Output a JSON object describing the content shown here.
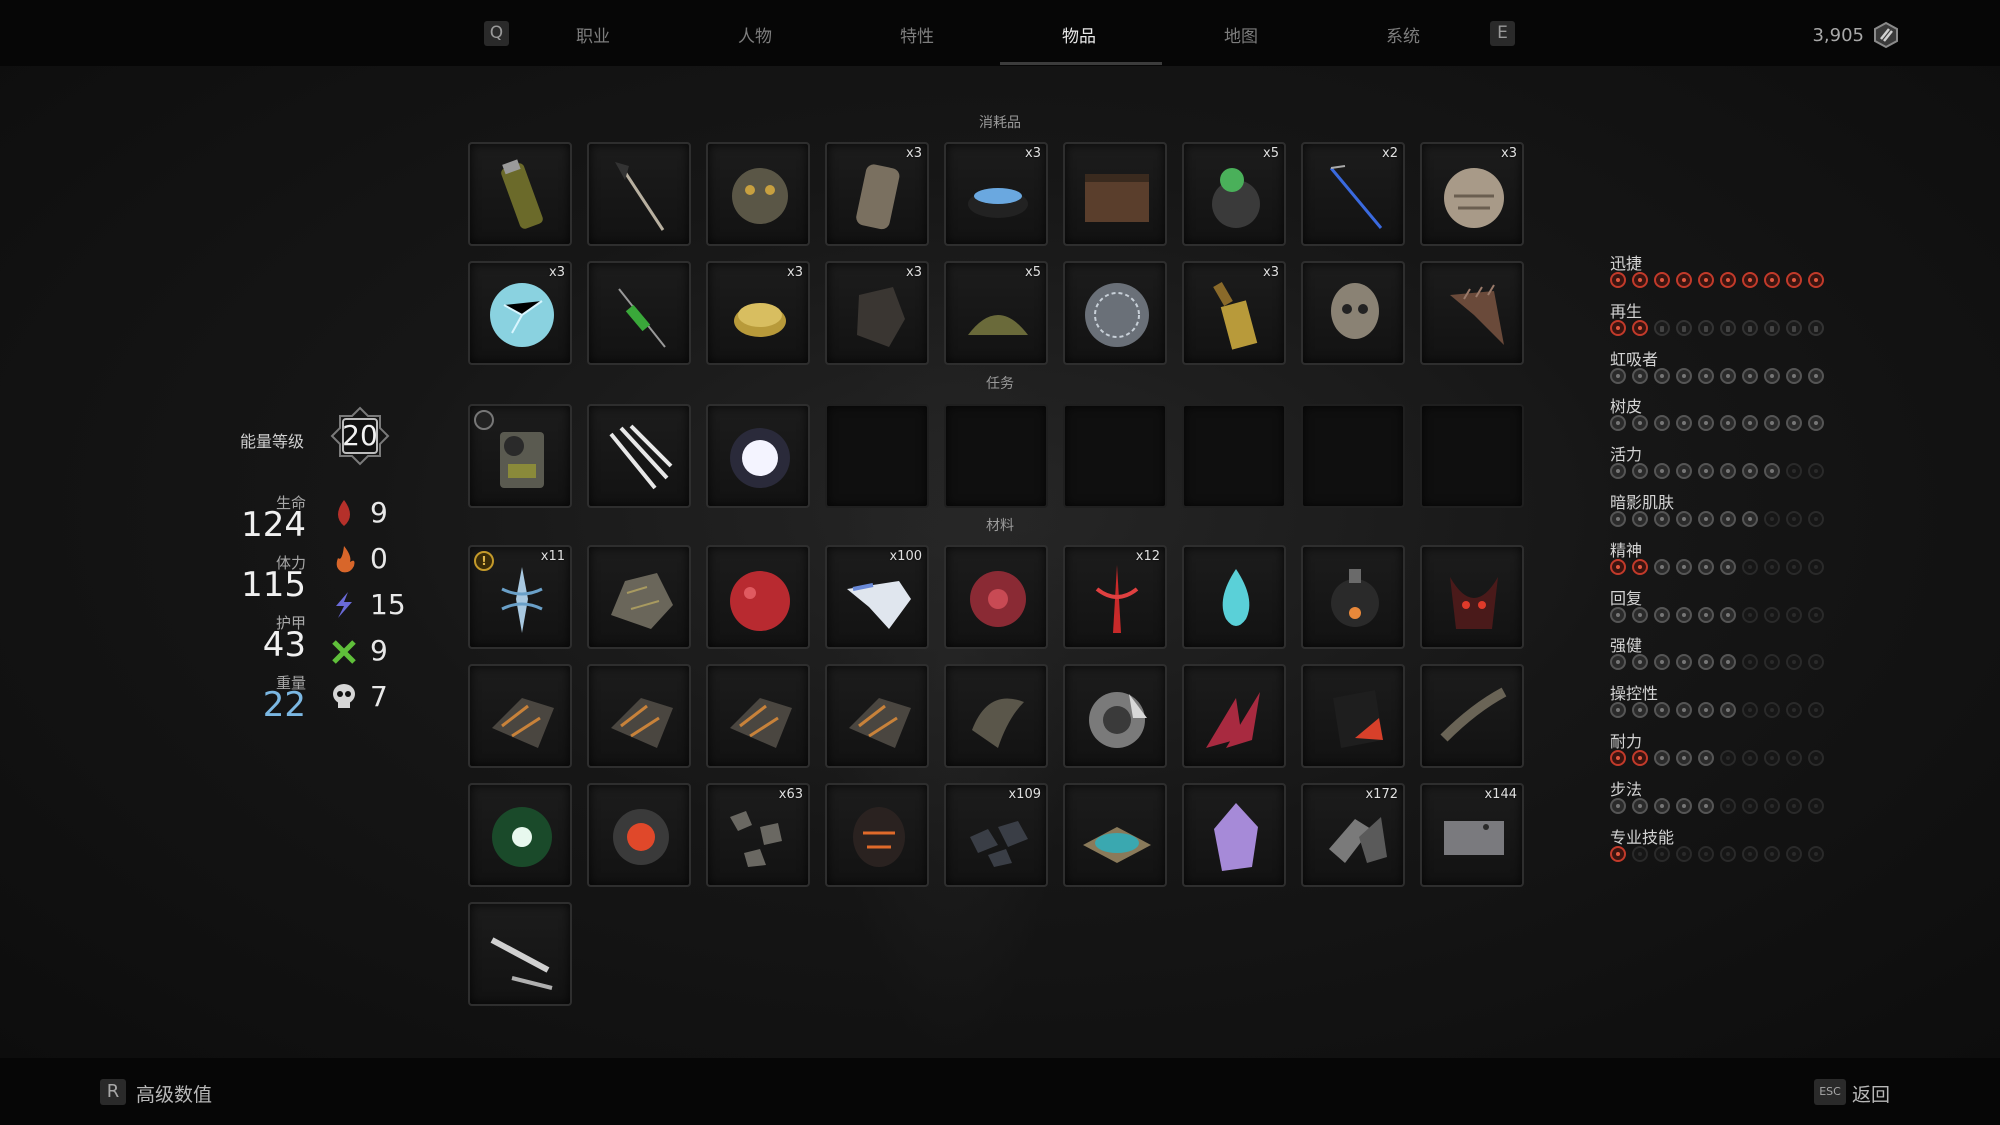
{
  "nav": {
    "left_key": "Q",
    "right_key": "E",
    "tabs": [
      {
        "label": "职业",
        "active": false
      },
      {
        "label": "人物",
        "active": false
      },
      {
        "label": "特性",
        "active": false
      },
      {
        "label": "物品",
        "active": true
      },
      {
        "label": "地图",
        "active": false
      },
      {
        "label": "系统",
        "active": false
      }
    ],
    "currency": {
      "value": "3,905",
      "icon": "scrap-currency-icon"
    }
  },
  "sections": {
    "consumables": "消耗品",
    "quest": "任务",
    "materials": "材料"
  },
  "consumables": [
    {
      "icon": "canister-item",
      "qty": ""
    },
    {
      "icon": "dart-item",
      "qty": ""
    },
    {
      "icon": "helmet-grenade-item",
      "qty": ""
    },
    {
      "icon": "bandage-roll-item",
      "qty": "x3"
    },
    {
      "icon": "bowl-salve-item",
      "qty": "x3"
    },
    {
      "icon": "ammo-box-item",
      "qty": ""
    },
    {
      "icon": "green-flask-item",
      "qty": "x5"
    },
    {
      "icon": "blue-needle-item",
      "qty": "x2"
    },
    {
      "icon": "stone-orb-item",
      "qty": "x3"
    },
    {
      "icon": "ice-orb-item",
      "qty": "x3"
    },
    {
      "icon": "green-syringe-item",
      "qty": ""
    },
    {
      "icon": "coin-stack-item",
      "qty": "x3"
    },
    {
      "icon": "dark-rock-item",
      "qty": "x3"
    },
    {
      "icon": "herb-pile-item",
      "qty": "x5"
    },
    {
      "icon": "engraved-sphere-item",
      "qty": ""
    },
    {
      "icon": "golden-bottle-item",
      "qty": "x3"
    },
    {
      "icon": "skull-item",
      "qty": ""
    },
    {
      "icon": "spiked-horn-item",
      "qty": ""
    }
  ],
  "quest_items": [
    {
      "icon": "radio-device-item",
      "qty": "",
      "marker": "ring"
    },
    {
      "icon": "crystal-shards-item",
      "qty": ""
    },
    {
      "icon": "glowing-orb-item",
      "qty": ""
    },
    {
      "icon": "",
      "qty": ""
    },
    {
      "icon": "",
      "qty": ""
    },
    {
      "icon": "",
      "qty": ""
    },
    {
      "icon": "",
      "qty": ""
    },
    {
      "icon": "",
      "qty": ""
    },
    {
      "icon": "",
      "qty": ""
    }
  ],
  "materials": [
    {
      "icon": "relic-shard-item",
      "qty": "x11",
      "marker": "warn"
    },
    {
      "icon": "ore-chunk-item",
      "qty": ""
    },
    {
      "icon": "red-heart-item",
      "qty": ""
    },
    {
      "icon": "scrap-fragment-item",
      "qty": "x100"
    },
    {
      "icon": "red-cluster-item",
      "qty": ""
    },
    {
      "icon": "red-rune-item",
      "qty": "x12"
    },
    {
      "icon": "blue-flame-item",
      "qty": ""
    },
    {
      "icon": "orb-lantern-item",
      "qty": ""
    },
    {
      "icon": "demon-mask-item",
      "qty": ""
    },
    {
      "icon": "metal-claw-item",
      "qty": ""
    },
    {
      "icon": "metal-claw-item",
      "qty": ""
    },
    {
      "icon": "metal-claw-item",
      "qty": ""
    },
    {
      "icon": "metal-claw-item",
      "qty": ""
    },
    {
      "icon": "larva-item",
      "qty": ""
    },
    {
      "icon": "gear-shield-item",
      "qty": ""
    },
    {
      "icon": "red-crystal-item",
      "qty": ""
    },
    {
      "icon": "black-red-block-item",
      "qty": ""
    },
    {
      "icon": "bone-spine-item",
      "qty": ""
    },
    {
      "icon": "green-vortex-item",
      "qty": ""
    },
    {
      "icon": "red-core-item",
      "qty": ""
    },
    {
      "icon": "rock-fragments-item",
      "qty": "x63"
    },
    {
      "icon": "lava-egg-item",
      "qty": ""
    },
    {
      "icon": "iron-lumps-item",
      "qty": "x109"
    },
    {
      "icon": "teal-ore-item",
      "qty": ""
    },
    {
      "icon": "amethyst-item",
      "qty": ""
    },
    {
      "icon": "metal-ingot-item",
      "qty": "x172"
    },
    {
      "icon": "metal-plate-item",
      "qty": "x144"
    },
    {
      "icon": "blade-shards-item",
      "qty": ""
    }
  ],
  "power": {
    "label": "能量等级",
    "value": "20"
  },
  "stats": [
    {
      "label": "生命",
      "value": "124"
    },
    {
      "label": "体力",
      "value": "115"
    },
    {
      "label": "护甲",
      "value": "43"
    },
    {
      "label": "重量",
      "value": "22"
    }
  ],
  "resistances": [
    {
      "icon": "bleed-drop-icon",
      "value": "9",
      "color": "#b5302a"
    },
    {
      "icon": "fire-icon",
      "value": "0",
      "color": "#d8662a"
    },
    {
      "icon": "lightning-icon",
      "value": "15",
      "color": "#6a6ad8"
    },
    {
      "icon": "acid-cross-icon",
      "value": "9",
      "color": "#5fbf3a"
    },
    {
      "icon": "skull-icon",
      "value": "7",
      "color": "#d6d6d6"
    }
  ],
  "traits": [
    {
      "name": "迅捷",
      "on": 10,
      "total": 10,
      "locked": 0
    },
    {
      "name": "再生",
      "on": 2,
      "total": 10,
      "locked": 8
    },
    {
      "name": "虹吸者",
      "on": 0,
      "total": 10,
      "locked": 0
    },
    {
      "name": "树皮",
      "on": 0,
      "total": 10,
      "locked": 0
    },
    {
      "name": "活力",
      "on": 0,
      "total": 8,
      "locked": 0,
      "partial_last": true
    },
    {
      "name": "暗影肌肤",
      "on": 0,
      "total": 7,
      "locked": 0
    },
    {
      "name": "精神",
      "on": 2,
      "total": 10,
      "locked": 0,
      "dim_after": 6
    },
    {
      "name": "回复",
      "on": 0,
      "total": 6,
      "locked": 0
    },
    {
      "name": "强健",
      "on": 0,
      "total": 6,
      "locked": 0
    },
    {
      "name": "操控性",
      "on": 0,
      "total": 10,
      "locked": 0,
      "dim_after": 6
    },
    {
      "name": "耐力",
      "on": 2,
      "total": 10,
      "locked": 0,
      "dim_after": 5
    },
    {
      "name": "步法",
      "on": 0,
      "total": 5,
      "locked": 0
    },
    {
      "name": "专业技能",
      "on": 1,
      "total": 10,
      "locked": 0,
      "dim_after": 1
    }
  ],
  "bottom": {
    "left_key": "R",
    "left_label": "高级数值",
    "right_key": "ESC",
    "right_label": "返回"
  }
}
